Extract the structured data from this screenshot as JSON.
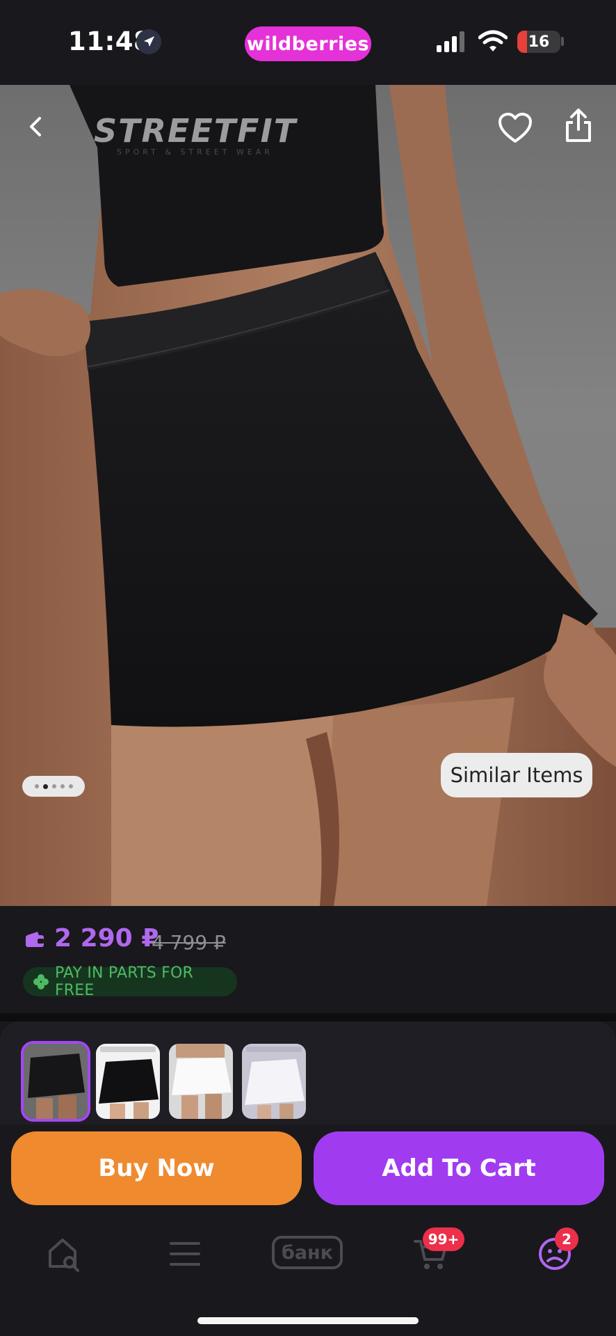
{
  "status": {
    "time": "11:48",
    "brand": "wildberries",
    "battery": "16"
  },
  "hero": {
    "brand_mark": "STREETFIT",
    "brand_tagline": "SPORT & STREET WEAR",
    "similar_label": "Similar Items",
    "image_count": 5,
    "active_image": 1
  },
  "price": {
    "current": "2 290 ₽",
    "old": "4 799 ₽",
    "installment": "PAY IN PARTS FOR FREE"
  },
  "variants": [
    {
      "name": "black",
      "selected": true
    },
    {
      "name": "black-flared",
      "selected": false
    },
    {
      "name": "white",
      "selected": false
    },
    {
      "name": "white-flared",
      "selected": false
    }
  ],
  "actions": {
    "buy_now": "Buy Now",
    "add_to_cart": "Add To Cart"
  },
  "tabbar": {
    "bank_label": "банк",
    "cart_badge": "99+",
    "profile_badge": "2"
  },
  "colors": {
    "brand": "#e531d8",
    "price": "#b068ee",
    "buy": "#ef8a2f",
    "cart": "#a13bf0",
    "installment": "#4fb964",
    "badge": "#ec2f4b"
  }
}
